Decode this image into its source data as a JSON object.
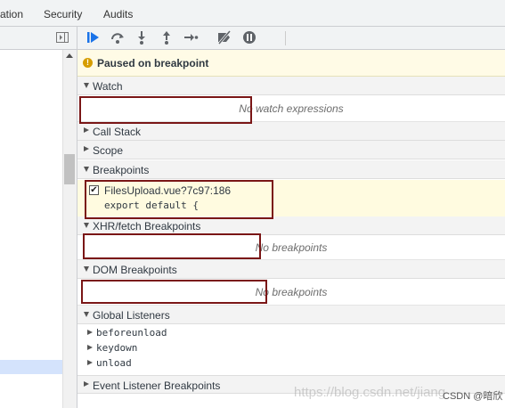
{
  "tabs": [
    "ation",
    "Security",
    "Audits"
  ],
  "toolbar": {
    "icons": [
      "resume-icon",
      "step-over-icon",
      "step-into-icon",
      "step-out-icon",
      "step-icon",
      "deactivate-breakpoints-icon",
      "pause-on-exceptions-icon"
    ]
  },
  "paused": {
    "text": "Paused on breakpoint"
  },
  "sections": {
    "watch": "Watch",
    "watch_empty": "No watch expressions",
    "call_stack": "Call Stack",
    "scope": "Scope",
    "breakpoints": "Breakpoints",
    "xhr": "XHR/fetch Breakpoints",
    "xhr_empty": "No breakpoints",
    "dom": "DOM Breakpoints",
    "dom_empty": "No breakpoints",
    "global_listeners": "Global Listeners",
    "event_listener": "Event Listener Breakpoints"
  },
  "breakpoint": {
    "checked": true,
    "file": "FilesUpload.vue?7c97:186",
    "code": "export default {"
  },
  "listeners": [
    "beforeunload",
    "keydown",
    "unload"
  ],
  "watermark": "https://blog.csdn.net/jiang",
  "csdn": "CSDN @暗欣",
  "colors": {
    "accent": "#1a73e8",
    "highlight": "#7a1616",
    "paused_bg": "#fffbe6"
  }
}
